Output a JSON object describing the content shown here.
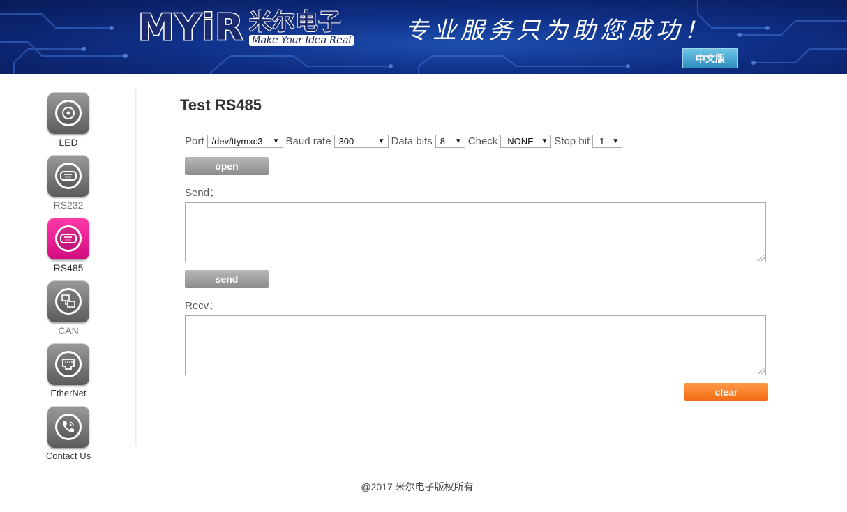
{
  "header": {
    "logo_text": "MYiR",
    "logo_cn": "米尔电子",
    "logo_tagline": "Make Your Idea Real",
    "slogan": "专业服务只为助您成功！",
    "lang_button": "中文版"
  },
  "sidebar": {
    "items": [
      {
        "label": "LED",
        "icon": "led-icon"
      },
      {
        "label": "RS232",
        "icon": "serial-port-icon"
      },
      {
        "label": "RS485",
        "icon": "serial-port-icon"
      },
      {
        "label": "CAN",
        "icon": "can-icon"
      },
      {
        "label": "EtherNet",
        "icon": "ethernet-icon"
      },
      {
        "label": "Contact Us",
        "icon": "phone-icon"
      }
    ],
    "active": "RS485"
  },
  "main": {
    "title": "Test RS485",
    "port_label": "Port",
    "port_value": "/dev/ttymxc3",
    "baud_label": "Baud rate",
    "baud_value": "300",
    "databits_label": "Data bits",
    "databits_value": "8",
    "check_label": "Check",
    "check_value": "NONE",
    "stopbit_label": "Stop bit",
    "stopbit_value": "1",
    "open_button": "open",
    "send_label": "Send：",
    "send_value": "",
    "send_button": "send",
    "recv_label": "Recv：",
    "recv_value": "",
    "clear_button": "clear"
  },
  "footer": {
    "copyright": "@2017 米尔电子版权所有"
  },
  "colors": {
    "active_nav": "#e0158a",
    "clear_button": "#f87a24",
    "lang_button": "#3a9cc9"
  }
}
